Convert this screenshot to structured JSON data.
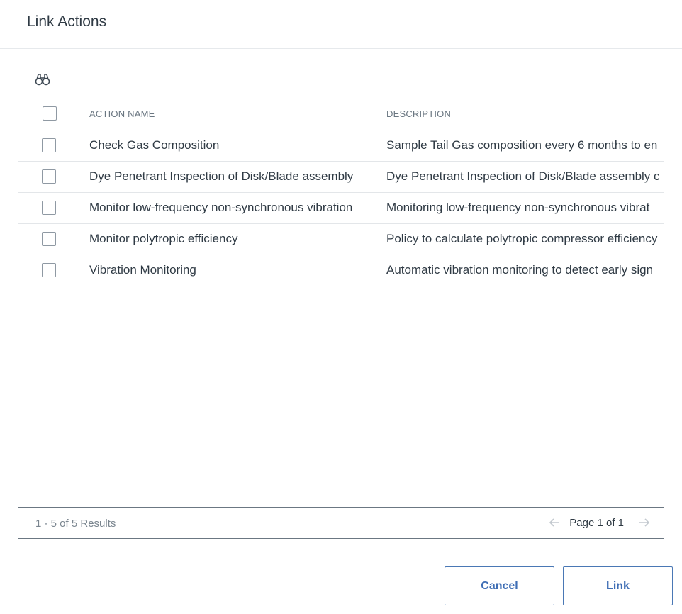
{
  "dialog": {
    "title": "Link Actions"
  },
  "toolbar": {
    "search_icon": "binoculars-icon"
  },
  "grid": {
    "columns": [
      {
        "key": "name",
        "label": "ACTION NAME"
      },
      {
        "key": "description",
        "label": "DESCRIPTION"
      }
    ],
    "rows": [
      {
        "name": "Check Gas Composition",
        "description": "Sample Tail Gas composition every 6 months to en",
        "checked": false
      },
      {
        "name": "Dye Penetrant Inspection of Disk/Blade assembly",
        "description": "Dye Penetrant Inspection of Disk/Blade assembly c",
        "checked": false
      },
      {
        "name": "Monitor low-frequency non-synchronous vibration",
        "description": "Monitoring low-frequency non-synchronous vibrat",
        "checked": false
      },
      {
        "name": "Monitor polytropic efficiency",
        "description": "Policy to calculate polytropic compressor efficiency",
        "checked": false
      },
      {
        "name": "Vibration Monitoring",
        "description": "Automatic vibration monitoring to detect early sign",
        "checked": false
      }
    ]
  },
  "footer": {
    "results": "1 - 5 of 5 Results",
    "page_text": "Page 1 of 1",
    "prev_icon": "arrow-left-icon",
    "next_icon": "arrow-right-icon"
  },
  "buttons": {
    "cancel": "Cancel",
    "link": "Link"
  },
  "colors": {
    "accent": "#3f6eb5",
    "border": "#6b7782",
    "text": "#2f3a44",
    "muted": "#7a858f"
  }
}
